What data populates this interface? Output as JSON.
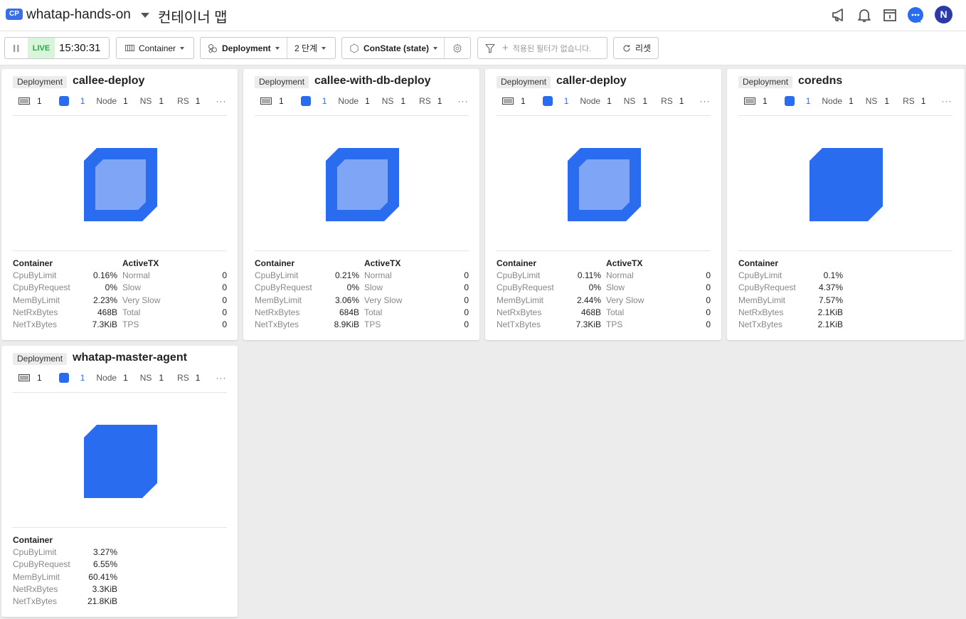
{
  "header": {
    "badge": "CP",
    "project": "whatap-hands-on",
    "title": "컨테이너 맵",
    "icons": [
      "megaphone-icon",
      "bell-icon",
      "calendar-info-icon",
      "chat-icon"
    ],
    "avatar": "N"
  },
  "toolbar": {
    "live_label": "LIVE",
    "time": "15:30:31",
    "view_select": "Container",
    "group_select": "Deployment",
    "group_level": "2 단계",
    "state_select": "ConState (state)",
    "filter_placeholder": "적용된 필터가 없습니다.",
    "reset_label": "리셋"
  },
  "cards": [
    {
      "tag": "Deployment",
      "name": "callee-deploy",
      "meta": {
        "ctr": "1",
        "pod": "1",
        "node_label": "Node",
        "node": "1",
        "ns_label": "NS",
        "ns": "1",
        "rs_label": "RS",
        "rs": "1"
      },
      "container_title": "Container",
      "metrics": [
        {
          "label": "CpuByLimit",
          "value": "0.16%"
        },
        {
          "label": "CpuByRequest",
          "value": "0%"
        },
        {
          "label": "MemByLimit",
          "value": "2.23%"
        },
        {
          "label": "NetRxBytes",
          "value": "468B"
        },
        {
          "label": "NetTxBytes",
          "value": "7.3KiB"
        }
      ],
      "activetx_title": "ActiveTX",
      "activetx": [
        {
          "label": "Normal",
          "value": "0"
        },
        {
          "label": "Slow",
          "value": "0"
        },
        {
          "label": "Very Slow",
          "value": "0"
        },
        {
          "label": "Total",
          "value": "0"
        },
        {
          "label": "TPS",
          "value": "0"
        }
      ]
    },
    {
      "tag": "Deployment",
      "name": "callee-with-db-deploy",
      "meta": {
        "ctr": "1",
        "pod": "1",
        "node_label": "Node",
        "node": "1",
        "ns_label": "NS",
        "ns": "1",
        "rs_label": "RS",
        "rs": "1"
      },
      "container_title": "Container",
      "metrics": [
        {
          "label": "CpuByLimit",
          "value": "0.21%"
        },
        {
          "label": "CpuByRequest",
          "value": "0%"
        },
        {
          "label": "MemByLimit",
          "value": "3.06%"
        },
        {
          "label": "NetRxBytes",
          "value": "684B"
        },
        {
          "label": "NetTxBytes",
          "value": "8.9KiB"
        }
      ],
      "activetx_title": "ActiveTX",
      "activetx": [
        {
          "label": "Normal",
          "value": "0"
        },
        {
          "label": "Slow",
          "value": "0"
        },
        {
          "label": "Very Slow",
          "value": "0"
        },
        {
          "label": "Total",
          "value": "0"
        },
        {
          "label": "TPS",
          "value": "0"
        }
      ]
    },
    {
      "tag": "Deployment",
      "name": "caller-deploy",
      "meta": {
        "ctr": "1",
        "pod": "1",
        "node_label": "Node",
        "node": "1",
        "ns_label": "NS",
        "ns": "1",
        "rs_label": "RS",
        "rs": "1"
      },
      "container_title": "Container",
      "metrics": [
        {
          "label": "CpuByLimit",
          "value": "0.11%"
        },
        {
          "label": "CpuByRequest",
          "value": "0%"
        },
        {
          "label": "MemByLimit",
          "value": "2.44%"
        },
        {
          "label": "NetRxBytes",
          "value": "468B"
        },
        {
          "label": "NetTxBytes",
          "value": "7.3KiB"
        }
      ],
      "activetx_title": "ActiveTX",
      "activetx": [
        {
          "label": "Normal",
          "value": "0"
        },
        {
          "label": "Slow",
          "value": "0"
        },
        {
          "label": "Very Slow",
          "value": "0"
        },
        {
          "label": "Total",
          "value": "0"
        },
        {
          "label": "TPS",
          "value": "0"
        }
      ]
    },
    {
      "tag": "Deployment",
      "name": "coredns",
      "meta": {
        "ctr": "1",
        "pod": "1",
        "node_label": "Node",
        "node": "1",
        "ns_label": "NS",
        "ns": "1",
        "rs_label": "RS",
        "rs": "1"
      },
      "container_title": "Container",
      "metrics": [
        {
          "label": "CpuByLimit",
          "value": "0.1%"
        },
        {
          "label": "CpuByRequest",
          "value": "4.37%"
        },
        {
          "label": "MemByLimit",
          "value": "7.57%"
        },
        {
          "label": "NetRxBytes",
          "value": "2.1KiB"
        },
        {
          "label": "NetTxBytes",
          "value": "2.1KiB"
        }
      ]
    },
    {
      "tag": "Deployment",
      "name": "whatap-master-agent",
      "meta": {
        "ctr": "1",
        "pod": "1",
        "node_label": "Node",
        "node": "1",
        "ns_label": "NS",
        "ns": "1",
        "rs_label": "RS",
        "rs": "1"
      },
      "container_title": "Container",
      "metrics": [
        {
          "label": "CpuByLimit",
          "value": "3.27%"
        },
        {
          "label": "CpuByRequest",
          "value": "6.55%"
        },
        {
          "label": "MemByLimit",
          "value": "60.41%"
        },
        {
          "label": "NetRxBytes",
          "value": "3.3KiB"
        },
        {
          "label": "NetTxBytes",
          "value": "21.8KiB"
        }
      ]
    }
  ],
  "colors": {
    "accent": "#2a6cf0",
    "container_inner": "#7fa6f6",
    "live_bg": "#d8f5dc",
    "live_text": "#28a745"
  }
}
